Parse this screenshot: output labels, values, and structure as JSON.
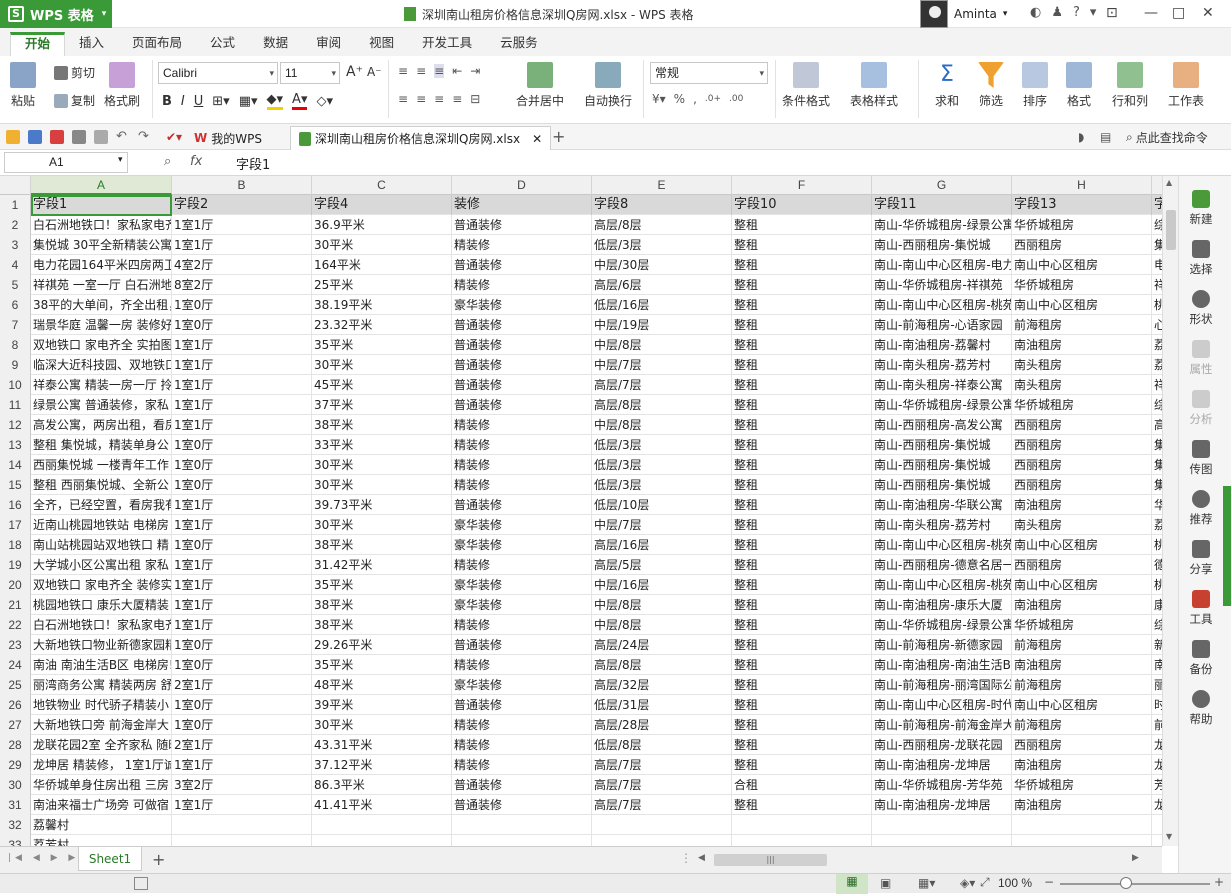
{
  "app": {
    "button_label": "WPS 表格",
    "window_title": "深圳南山租房价格信息深圳Q房网.xlsx - WPS 表格",
    "user_name": "Aminta",
    "accent": "#3a9a38"
  },
  "tabs": [
    "开始",
    "插入",
    "页面布局",
    "公式",
    "数据",
    "审阅",
    "视图",
    "开发工具",
    "云服务"
  ],
  "ribbon": {
    "paste": "粘贴",
    "cut": "剪切",
    "copy": "复制",
    "format_painter": "格式刷",
    "font_name": "Calibri",
    "font_size": "11",
    "merge_center": "合并居中",
    "wrap_text": "自动换行",
    "number_format": "常规",
    "cond_format": "条件格式",
    "table_style": "表格样式",
    "sum": "求和",
    "filter": "筛选",
    "sort": "排序",
    "format": "格式",
    "rows_cols": "行和列",
    "worksheet": "工作表"
  },
  "quickbar": {
    "my_wps": "我的WPS",
    "doc_tab": "深圳南山租房价格信息深圳Q房网.xlsx",
    "find_cmd": "点此查找命令"
  },
  "formula_bar": {
    "cell_ref": "A1",
    "content": "字段1"
  },
  "columns": [
    "A",
    "B",
    "C",
    "D",
    "E",
    "F",
    "G",
    "H"
  ],
  "rows": [
    [
      "1",
      "字段1",
      "字段2",
      "字段4",
      "装修",
      "字段8",
      "字段10",
      "字段11",
      "字段13",
      "字"
    ],
    [
      "2",
      "白石洲地铁口！家私家电齐",
      "1室1厅",
      "36.9平米",
      "普通装修",
      "高层/8层",
      "整租",
      "南山-华侨城租房-绿景公寓",
      "华侨城租房",
      "综"
    ],
    [
      "3",
      "集悦城 30平全新精装公寓",
      "1室1厅",
      "30平米",
      "精装修",
      "低层/3层",
      "整租",
      "南山-西丽租房-集悦城",
      "西丽租房",
      "集"
    ],
    [
      "4",
      "电力花园164平米四房两卫",
      "4室2厅",
      "164平米",
      "普通装修",
      "中层/30层",
      "整租",
      "南山-南山中心区租房-电力花园",
      "南山中心区租房",
      "电"
    ],
    [
      "5",
      "祥祺苑 一室一厅 白石洲地",
      "8室2厅",
      "25平米",
      "精装修",
      "高层/6层",
      "整租",
      "南山-华侨城租房-祥祺苑",
      "华侨城租房",
      "祥"
    ],
    [
      "6",
      "38平的大单间，齐全出租，",
      "1室0厅",
      "38.19平米",
      "豪华装修",
      "低层/16层",
      "整租",
      "南山-南山中心区租房-桃苑",
      "南山中心区租房",
      "桃"
    ],
    [
      "7",
      "瑞景华庭 温馨一房 装修好",
      "1室0厅",
      "23.32平米",
      "普通装修",
      "中层/19层",
      "整租",
      "南山-前海租房-心语家园",
      "前海租房",
      "心"
    ],
    [
      "8",
      "双地铁口 家电齐全 实拍图",
      "1室1厅",
      "35平米",
      "普通装修",
      "中层/8层",
      "整租",
      "南山-南油租房-荔馨村",
      "南油租房",
      "荔"
    ],
    [
      "9",
      "临深大近科技园、双地铁口",
      "1室1厅",
      "30平米",
      "普通装修",
      "中层/7层",
      "整租",
      "南山-南头租房-荔芳村",
      "南头租房",
      "荔"
    ],
    [
      "10",
      "祥泰公寓 精装一房一厅 拎",
      "1室1厅",
      "45平米",
      "普通装修",
      "高层/7层",
      "整租",
      "南山-南头租房-祥泰公寓",
      "南头租房",
      "祥"
    ],
    [
      "11",
      "绿景公寓 普通装修，家私",
      "1室1厅",
      "37平米",
      "普通装修",
      "高层/8层",
      "整租",
      "南山-华侨城租房-绿景公寓",
      "华侨城租房",
      "综"
    ],
    [
      "12",
      "高发公寓，两房出租，看房",
      "1室1厅",
      "38平米",
      "精装修",
      "中层/8层",
      "整租",
      "南山-西丽租房-高发公寓",
      "西丽租房",
      "高"
    ],
    [
      "13",
      "整租 集悦城，精装单身公",
      "1室0厅",
      "33平米",
      "精装修",
      "低层/3层",
      "整租",
      "南山-西丽租房-集悦城",
      "西丽租房",
      "集"
    ],
    [
      "14",
      "西丽集悦城 一楼青年工作",
      "1室0厅",
      "30平米",
      "精装修",
      "低层/3层",
      "整租",
      "南山-西丽租房-集悦城",
      "西丽租房",
      "集"
    ],
    [
      "15",
      "整租 西丽集悦城、全新公",
      "1室0厅",
      "30平米",
      "精装修",
      "低层/3层",
      "整租",
      "南山-西丽租房-集悦城",
      "西丽租房",
      "集"
    ],
    [
      "16",
      "全齐，已经空置，看房我有",
      "1室1厅",
      "39.73平米",
      "普通装修",
      "低层/10层",
      "整租",
      "南山-南油租房-华联公寓",
      "南油租房",
      "华"
    ],
    [
      "17",
      "近南山桃园地铁站 电梯房",
      "1室1厅",
      "30平米",
      "豪华装修",
      "中层/7层",
      "整租",
      "南山-南头租房-荔芳村",
      "南头租房",
      "荔"
    ],
    [
      "18",
      "南山站桃园站双地铁口 精",
      "1室0厅",
      "38平米",
      "豪华装修",
      "高层/16层",
      "整租",
      "南山-南山中心区租房-桃苑",
      "南山中心区租房",
      "桃"
    ],
    [
      "19",
      "大学城小区公寓出租 家私",
      "1室1厅",
      "31.42平米",
      "精装修",
      "高层/5层",
      "整租",
      "南山-西丽租房-德意名居一期",
      "西丽租房",
      "德"
    ],
    [
      "20",
      "双地铁口 家电齐全 装修实",
      "1室1厅",
      "35平米",
      "豪华装修",
      "中层/16层",
      "整租",
      "南山-南山中心区租房-桃苑",
      "南山中心区租房",
      "桃"
    ],
    [
      "21",
      "桃园地铁口 康乐大厦精装",
      "1室1厅",
      "38平米",
      "豪华装修",
      "中层/8层",
      "整租",
      "南山-南油租房-康乐大厦",
      "南油租房",
      "康"
    ],
    [
      "22",
      "白石洲地铁口！家私家电齐",
      "1室1厅",
      "38平米",
      "精装修",
      "中层/8层",
      "整租",
      "南山-华侨城租房-绿景公寓",
      "华侨城租房",
      "综"
    ],
    [
      "23",
      "大新地铁口物业新德家园精",
      "1室0厅",
      "29.26平米",
      "普通装修",
      "高层/24层",
      "整租",
      "南山-前海租房-新德家园",
      "前海租房",
      "新"
    ],
    [
      "24",
      "南油 南油生活B区 电梯房!",
      "1室0厅",
      "35平米",
      "精装修",
      "高层/8层",
      "整租",
      "南山-南油租房-南油生活B区",
      "南油租房",
      "南"
    ],
    [
      "25",
      "丽湾商务公寓 精装两房 舒",
      "2室1厅",
      "48平米",
      "豪华装修",
      "高层/32层",
      "整租",
      "南山-前海租房-丽湾国际公寓",
      "前海租房",
      "丽"
    ],
    [
      "26",
      "地铁物业 时代骄子精装小",
      "1室0厅",
      "39平米",
      "普通装修",
      "低层/31层",
      "整租",
      "南山-南山中心区租房-时代骄子",
      "南山中心区租房",
      "时"
    ],
    [
      "27",
      "大新地铁口旁 前海金岸大",
      "1室0厅",
      "30平米",
      "精装修",
      "高层/28层",
      "整租",
      "南山-前海租房-前海金岸大厦",
      "前海租房",
      "前"
    ],
    [
      "28",
      "龙联花园2室 全齐家私 随时",
      "2室1厅",
      "43.31平米",
      "精装修",
      "低层/8层",
      "整租",
      "南山-西丽租房-龙联花园",
      "西丽租房",
      "龙"
    ],
    [
      "29",
      "龙坤居 精装修， 1室1厅诚",
      "1室1厅",
      "37.12平米",
      "精装修",
      "高层/7层",
      "整租",
      "南山-南油租房-龙坤居",
      "南油租房",
      "龙"
    ],
    [
      "30",
      "华侨城单身住房出租 三房",
      "3室2厅",
      "86.3平米",
      "普通装修",
      "高层/7层",
      "合租",
      "南山-华侨城租房-芳华苑",
      "华侨城租房",
      "芳"
    ],
    [
      "31",
      "南油来福士广场旁 可做宿",
      "1室1厅",
      "41.41平米",
      "普通装修",
      "高层/7层",
      "整租",
      "南山-南油租房-龙坤居",
      "南油租房",
      "龙"
    ],
    [
      "32",
      "荔馨村",
      "",
      "",
      "",
      "",
      "",
      "",
      "",
      ""
    ],
    [
      "33",
      "荔芳村",
      "",
      "",
      "",
      "",
      "",
      "",
      "",
      ""
    ]
  ],
  "right_panel": [
    "新建",
    "选择",
    "形状",
    "属性",
    "分析",
    "传图",
    "推荐",
    "分享",
    "工具",
    "备份",
    "帮助"
  ],
  "sheet_tab": "Sheet1",
  "status": {
    "zoom": "100 %"
  }
}
